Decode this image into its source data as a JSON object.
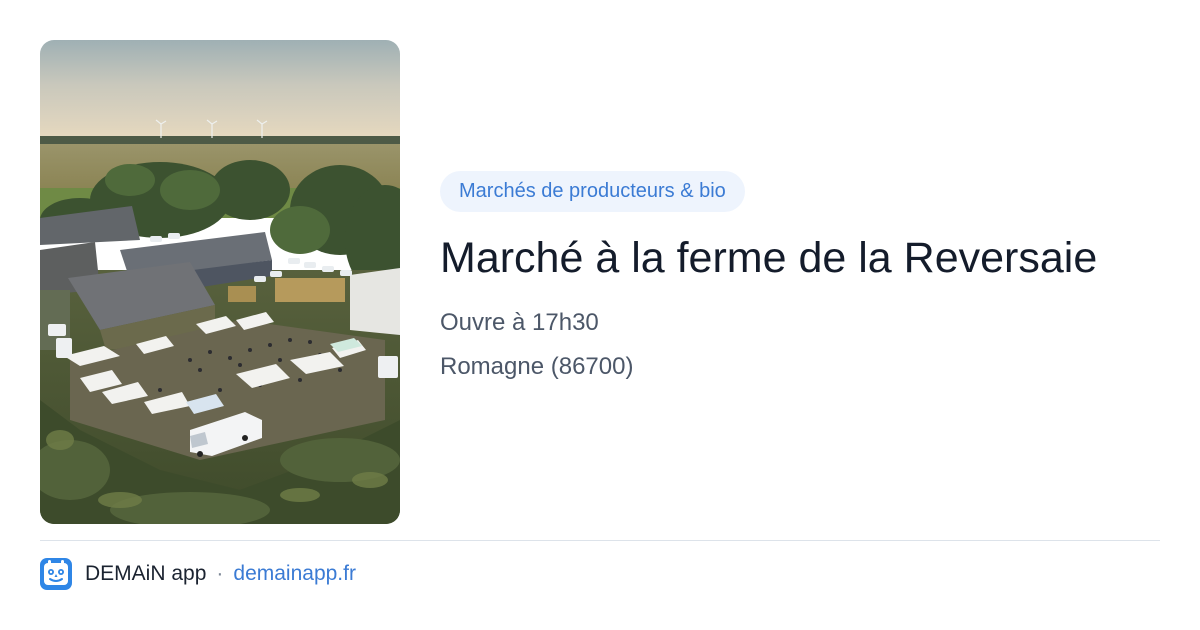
{
  "event": {
    "photo_icon": "farm-market-aerial-photo",
    "category": "Marchés de producteurs & bio",
    "title": "Marché à la ferme de la Reversaie",
    "hours": "Ouvre à 17h30",
    "location": "Romagne (86700)"
  },
  "footer": {
    "app_icon": "demain-logo-icon",
    "app_name": "DEMAiN app",
    "separator": "·",
    "domain": "demainapp.fr"
  },
  "colors": {
    "badge_background": "#eef4fd",
    "accent_blue": "#3b7bd4",
    "title_text": "#141c2b",
    "meta_text": "#4c5768",
    "divider": "#dde3ea"
  }
}
